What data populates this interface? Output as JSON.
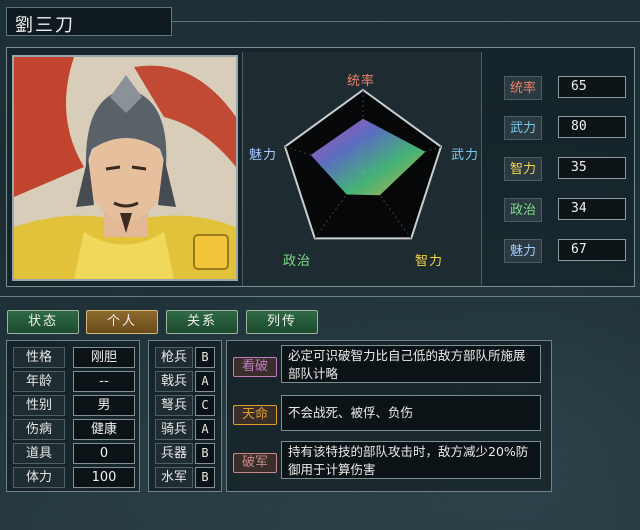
{
  "header": {
    "name": "劉三刀"
  },
  "radar": {
    "labels": {
      "top": "统率",
      "right": "武力",
      "bottom_right": "智力",
      "bottom_left": "政治",
      "left": "魅力"
    },
    "values": {
      "lead": 65,
      "war": 80,
      "int": 35,
      "pol": 34,
      "chr": 67
    },
    "max": 100
  },
  "stats": [
    {
      "label": "统率",
      "value": "65",
      "color": "#f07f6a"
    },
    {
      "label": "武力",
      "value": "80",
      "color": "#7ec8e8"
    },
    {
      "label": "智力",
      "value": "35",
      "color": "#f2d34a"
    },
    {
      "label": "政治",
      "value": "34",
      "color": "#7fdc8a"
    },
    {
      "label": "魅力",
      "value": "67",
      "color": "#a8c8ff"
    }
  ],
  "tabs": [
    "状态",
    "个人",
    "关系",
    "列传"
  ],
  "active_tab": "个人",
  "personal": [
    {
      "label": "性格",
      "value": "刚胆"
    },
    {
      "label": "年龄",
      "value": "--"
    },
    {
      "label": "性别",
      "value": "男"
    },
    {
      "label": "伤病",
      "value": "健康"
    },
    {
      "label": "道具",
      "value": "0"
    },
    {
      "label": "体力",
      "value": "100"
    }
  ],
  "troops": [
    {
      "label": "枪兵",
      "grade": "B"
    },
    {
      "label": "戟兵",
      "grade": "A"
    },
    {
      "label": "弩兵",
      "grade": "C"
    },
    {
      "label": "骑兵",
      "grade": "A"
    },
    {
      "label": "兵器",
      "grade": "B"
    },
    {
      "label": "水军",
      "grade": "B"
    }
  ],
  "skills": [
    {
      "name": "看破",
      "desc": "必定可识破智力比自己低的敌方部队所施展部队计略",
      "color": "#c07cc0"
    },
    {
      "name": "天命",
      "desc": "不会战死、被俘、负伤",
      "color": "#e0a030"
    },
    {
      "name": "破军",
      "desc": "持有该特技的部队攻击时，敌方减少20%防御用于计算伤害",
      "color": "#c78a8a"
    }
  ]
}
